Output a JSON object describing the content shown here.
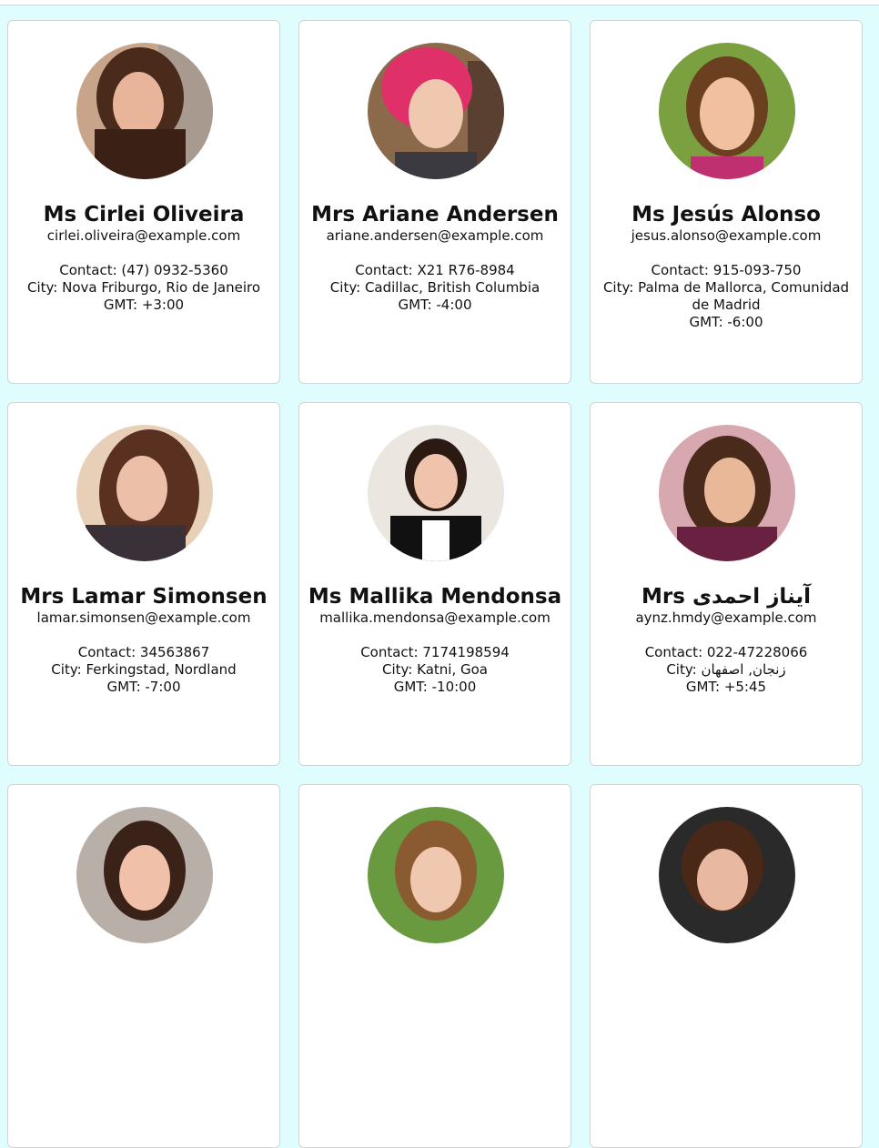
{
  "labels": {
    "contact": "Contact: ",
    "city": "City: ",
    "gmt": "GMT: "
  },
  "users": [
    {
      "name": "Ms Cirlei Oliveira",
      "email": "cirlei.oliveira@example.com",
      "contact": "(47) 0932-5360",
      "city": "Nova Friburgo, Rio de Janeiro",
      "gmt": "+3:00",
      "photo": "user-photo"
    },
    {
      "name": "Mrs Ariane Andersen",
      "email": "ariane.andersen@example.com",
      "contact": "X21 R76-8984",
      "city": "Cadillac, British Columbia",
      "gmt": "-4:00",
      "photo": "user-photo"
    },
    {
      "name": "Ms Jesús Alonso",
      "email": "jesus.alonso@example.com",
      "contact": "915-093-750",
      "city": "Palma de Mallorca, Comunidad de Madrid",
      "gmt": "-6:00",
      "photo": "user-photo"
    },
    {
      "name": "Mrs Lamar Simonsen",
      "email": "lamar.simonsen@example.com",
      "contact": "34563867",
      "city": "Ferkingstad, Nordland",
      "gmt": "-7:00",
      "photo": "user-photo"
    },
    {
      "name": "Ms Mallika Mendonsa",
      "email": "mallika.mendonsa@example.com",
      "contact": "7174198594",
      "city": "Katni, Goa",
      "gmt": "-10:00",
      "photo": "user-photo"
    },
    {
      "name": "Mrs آیناز احمدی",
      "email": "aynz.hmdy@example.com",
      "contact": "022-47228066",
      "city": "زنجان, اصفهان",
      "gmt": "+5:45",
      "photo": "user-photo"
    },
    {
      "name": "",
      "email": "",
      "contact": "",
      "city": "",
      "gmt": "",
      "photo": "user-photo"
    },
    {
      "name": "",
      "email": "",
      "contact": "",
      "city": "",
      "gmt": "",
      "photo": "user-photo"
    },
    {
      "name": "",
      "email": "",
      "contact": "",
      "city": "",
      "gmt": "",
      "photo": "user-photo"
    }
  ]
}
